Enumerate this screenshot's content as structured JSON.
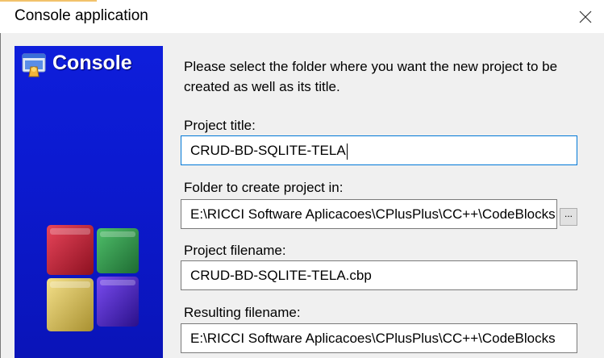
{
  "window": {
    "title": "Console application",
    "close_glyph": "✕"
  },
  "banner": {
    "title": "Console",
    "icon": "console-app-icon",
    "logo": "codeblocks-cubes-logo"
  },
  "intro_text": "Please select the folder where you want the new project to be created as well as its title.",
  "fields": {
    "project_title": {
      "label": "Project title:",
      "value": "CRUD-BD-SQLITE-TELA"
    },
    "folder": {
      "label": "Folder to create project in:",
      "value": "E:\\RICCI Software Aplicacoes\\CPlusPlus\\CC++\\CodeBlocks",
      "browse_label": "..."
    },
    "project_filename": {
      "label": "Project filename:",
      "value": "CRUD-BD-SQLITE-TELA.cbp"
    },
    "resulting_filename": {
      "label": "Resulting filename:",
      "value": "E:\\RICCI Software Aplicacoes\\CPlusPlus\\CC++\\CodeBlocks"
    }
  },
  "colors": {
    "banner_blue": "#0c1ad0",
    "focus_border": "#0078d7"
  }
}
